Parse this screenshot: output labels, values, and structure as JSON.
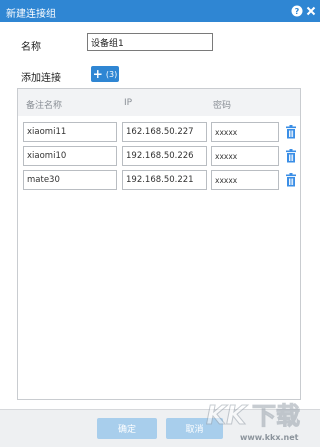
{
  "window": {
    "title": "新建连接组",
    "help_icon": "help-icon",
    "close_icon": "close-icon"
  },
  "form": {
    "name_label": "名称",
    "name_value": "设备组1",
    "add_label": "添加连接",
    "add_count": "(3)"
  },
  "table": {
    "columns": [
      "备注名称",
      "IP",
      "密码"
    ],
    "rows": [
      {
        "name": "xiaomi11",
        "ip": "162.168.50.227",
        "password": "xxxxx"
      },
      {
        "name": "xiaomi10",
        "ip": "192.168.50.226",
        "password": "xxxxx"
      },
      {
        "name": "mate30",
        "ip": "192.168.50.221",
        "password": "xxxxx"
      }
    ]
  },
  "footer": {
    "ok_label": "确定",
    "cancel_label": "取消"
  },
  "watermark": {
    "logo_text": "KK下载",
    "url": "www.kkx.net"
  },
  "colors": {
    "accent": "#2f86d3",
    "button_disabled": "#a8ceec",
    "trash": "#3a8ee6"
  }
}
